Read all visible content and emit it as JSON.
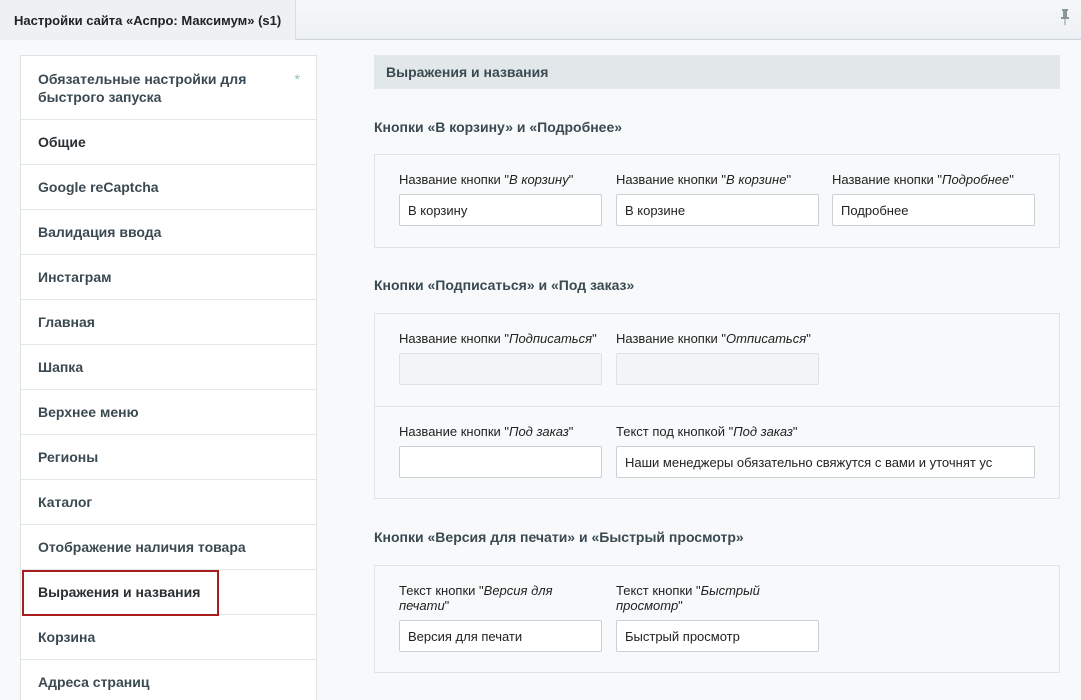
{
  "window": {
    "tab_title": "Настройки сайта «Аспро: Максимум» (s1)"
  },
  "sidebar": {
    "items": [
      {
        "label": "Обязательные настройки для быстрого запуска",
        "star": "*"
      },
      {
        "label": "Общие"
      },
      {
        "label": "Google reCaptcha"
      },
      {
        "label": "Валидация ввода"
      },
      {
        "label": "Инстаграм"
      },
      {
        "label": "Главная"
      },
      {
        "label": "Шапка"
      },
      {
        "label": "Верхнее меню"
      },
      {
        "label": "Регионы"
      },
      {
        "label": "Каталог"
      },
      {
        "label": "Отображение наличия товара"
      },
      {
        "label": "Выражения и названия"
      },
      {
        "label": "Корзина"
      },
      {
        "label": "Адреса страниц"
      }
    ],
    "active_index": 11
  },
  "main": {
    "section_title": "Выражения и названия",
    "groups": [
      {
        "title": "Кнопки «В корзину» и «Подробнее»",
        "fields": [
          {
            "label_prefix": "Название кнопки \"",
            "label_italic": "В корзину",
            "label_suffix": "\"",
            "value": "В корзину"
          },
          {
            "label_prefix": "Название кнопки \"",
            "label_italic": "В корзине",
            "label_suffix": "\"",
            "value": "В корзине"
          },
          {
            "label_prefix": "Название кнопки \"",
            "label_italic": "Подробнее",
            "label_suffix": "\"",
            "value": "Подробнее"
          }
        ]
      },
      {
        "title": "Кнопки «Подписаться» и «Под заказ»",
        "fields": [
          {
            "label_prefix": "Название кнопки \"",
            "label_italic": "Подписаться",
            "label_suffix": "\"",
            "value": ""
          },
          {
            "label_prefix": "Название кнопки \"",
            "label_italic": "Отписаться",
            "label_suffix": "\"",
            "value": ""
          },
          {
            "label_prefix": "Название кнопки \"",
            "label_italic": "Под заказ",
            "label_suffix": "\"",
            "value": ""
          },
          {
            "label_prefix": "Текст под кнопкой \"",
            "label_italic": "Под заказ",
            "label_suffix": "\"",
            "value": "Наши менеджеры обязательно свяжутся с вами и уточнят ус"
          }
        ]
      },
      {
        "title": "Кнопки «Версия для печати» и «Быстрый просмотр»",
        "fields": [
          {
            "label_prefix": "Текст кнопки \"",
            "label_italic": "Версия для печати",
            "label_suffix": "\"",
            "value": "Версия для печати"
          },
          {
            "label_prefix": "Текст кнопки \"",
            "label_italic": "Быстрый просмотр",
            "label_suffix": "\"",
            "value": "Быстрый просмотр"
          }
        ]
      }
    ]
  },
  "colors": {
    "active_border": "#a81d1d",
    "star": "#8ec1b9",
    "section_bg": "#e2e8ea"
  },
  "icons": {
    "pin": "pin-icon"
  }
}
